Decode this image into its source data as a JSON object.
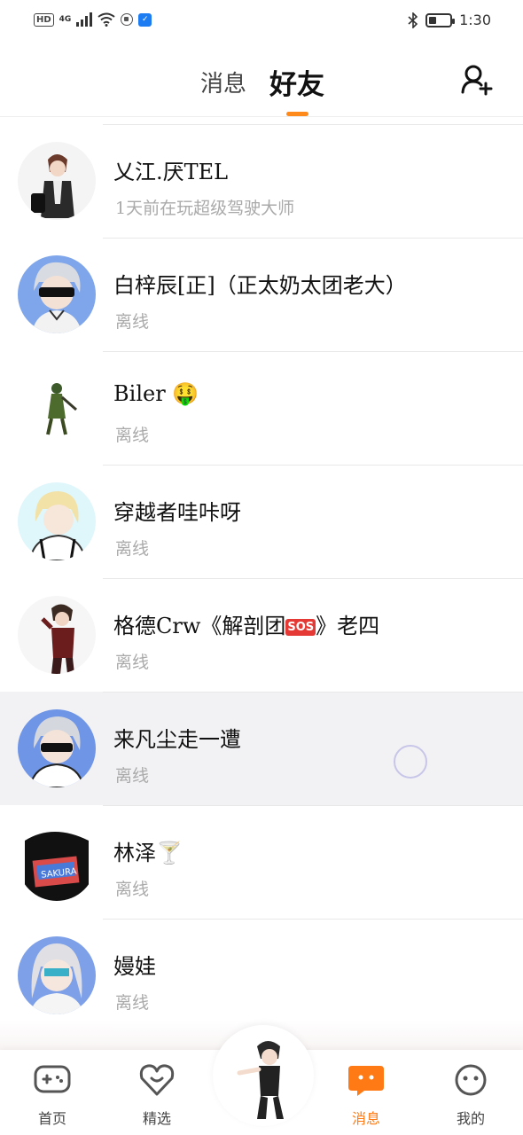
{
  "status_bar": {
    "left_label": "HD",
    "network": "4G",
    "time": "1:30"
  },
  "header": {
    "tabs": [
      {
        "label": "消息"
      },
      {
        "label": "好友"
      }
    ],
    "active_tab": "好友"
  },
  "friends": [
    {
      "name": "乂江.厌TEL",
      "status": "1天前在玩超级驾驶大师"
    },
    {
      "name": "白梓辰[正]（正太奶太团老大）",
      "status": "离线"
    },
    {
      "name": "Biler",
      "emoji": "🤑",
      "status": "离线"
    },
    {
      "name": "穿越者哇咔呀",
      "status": "离线"
    },
    {
      "name": "格德Crw《解剖团",
      "badge": "SOS",
      "name_suffix": "》老四",
      "status": "离线"
    },
    {
      "name": "来凡尘走一遭",
      "status": "离线"
    },
    {
      "name": "林泽",
      "emoji": "🍸",
      "status": "离线"
    },
    {
      "name": "嫚娃",
      "status": "离线"
    }
  ],
  "bottom_nav": {
    "items": [
      {
        "label": "首页"
      },
      {
        "label": "精选"
      },
      {
        "label": "消息"
      },
      {
        "label": "我的"
      }
    ],
    "active": "消息"
  },
  "colors": {
    "accent": "#ff7a14",
    "muted_text": "#aaaaaa",
    "pressed_row": "#f2f2f5"
  }
}
